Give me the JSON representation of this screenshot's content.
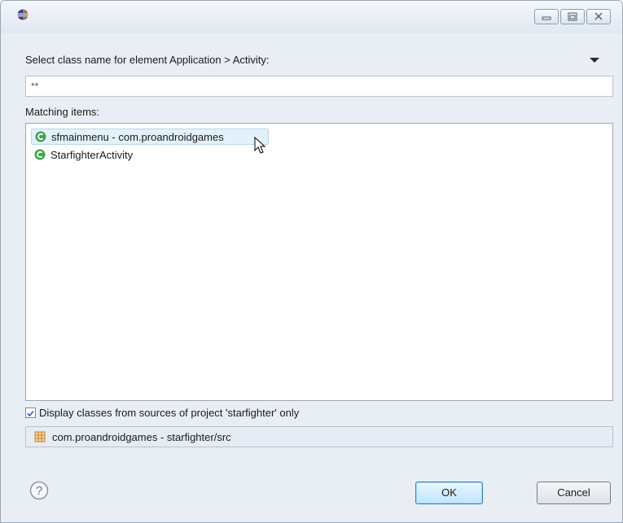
{
  "dialog": {
    "prompt": "Select class name for element Application > Activity:",
    "search_value": "**",
    "matching_label": "Matching items:",
    "items": [
      {
        "label": "sfmainmenu - com.proandroidgames",
        "icon": "class-icon",
        "selected": true
      },
      {
        "label": "StarfighterActivity",
        "icon": "class-icon",
        "selected": false
      }
    ],
    "filter_checkbox": {
      "label": "Display classes from sources of project 'starfighter' only",
      "checked": true
    },
    "status": {
      "icon": "package-icon",
      "text": "com.proandroidgames - starfighter/src"
    },
    "ok_label": "OK",
    "cancel_label": "Cancel"
  },
  "colors": {
    "class_icon": "#3fa64a",
    "package_icon": "#c8812b",
    "selection": "#e3f1fb"
  }
}
